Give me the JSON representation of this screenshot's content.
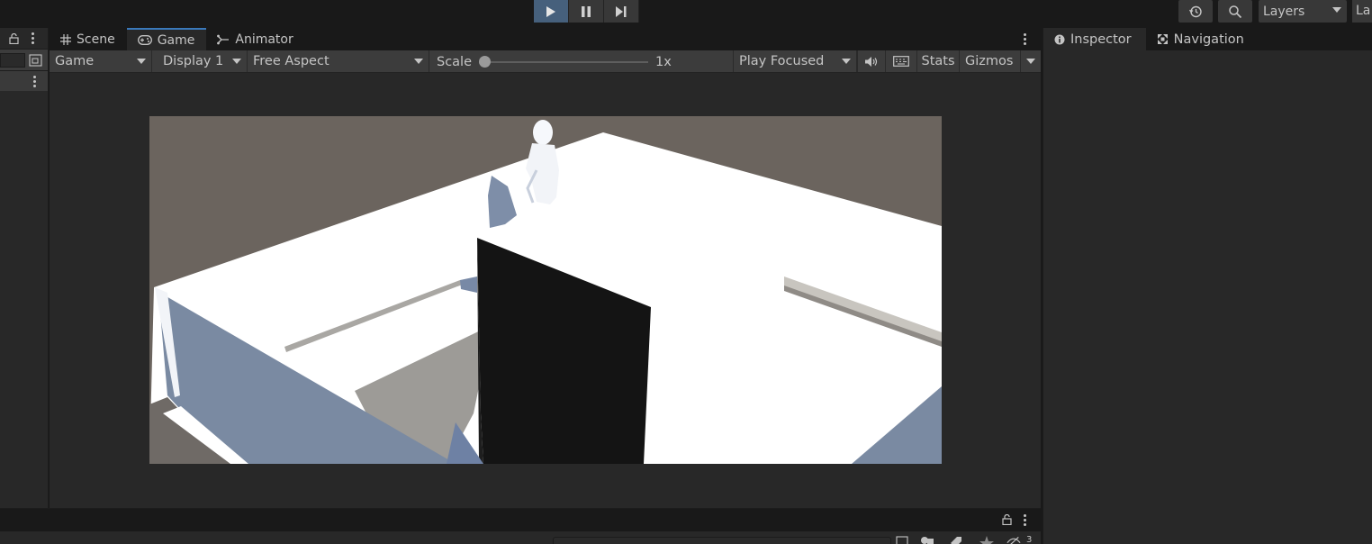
{
  "toolbar": {
    "play_icon": "play-icon",
    "pause_icon": "pause-icon",
    "step_icon": "step-icon",
    "history_icon": "history-icon",
    "search_icon": "search-icon",
    "layers_label": "Layers",
    "layout_label": "La"
  },
  "game_view": {
    "tabs": [
      {
        "label": "Scene",
        "icon": "grid-icon"
      },
      {
        "label": "Game",
        "icon": "gamepad-icon"
      },
      {
        "label": "Animator",
        "icon": "animator-icon"
      }
    ],
    "display_mode": "Game",
    "display": "Display 1",
    "aspect": "Free Aspect",
    "scale_label": "Scale",
    "scale_value": "1x",
    "play_mode": "Play Focused",
    "stats_label": "Stats",
    "gizmos_label": "Gizmos"
  },
  "inspector": {
    "tabs": [
      {
        "label": "Inspector",
        "icon": "info-icon"
      },
      {
        "label": "Navigation",
        "icon": "navigation-icon"
      }
    ]
  },
  "bottom": {
    "search_placeholder": "",
    "hidden_count": "3"
  },
  "colors": {
    "accent": "#3a79bb",
    "play_active": "#46607c",
    "panel": "#282828",
    "toolbar": "#191919"
  }
}
